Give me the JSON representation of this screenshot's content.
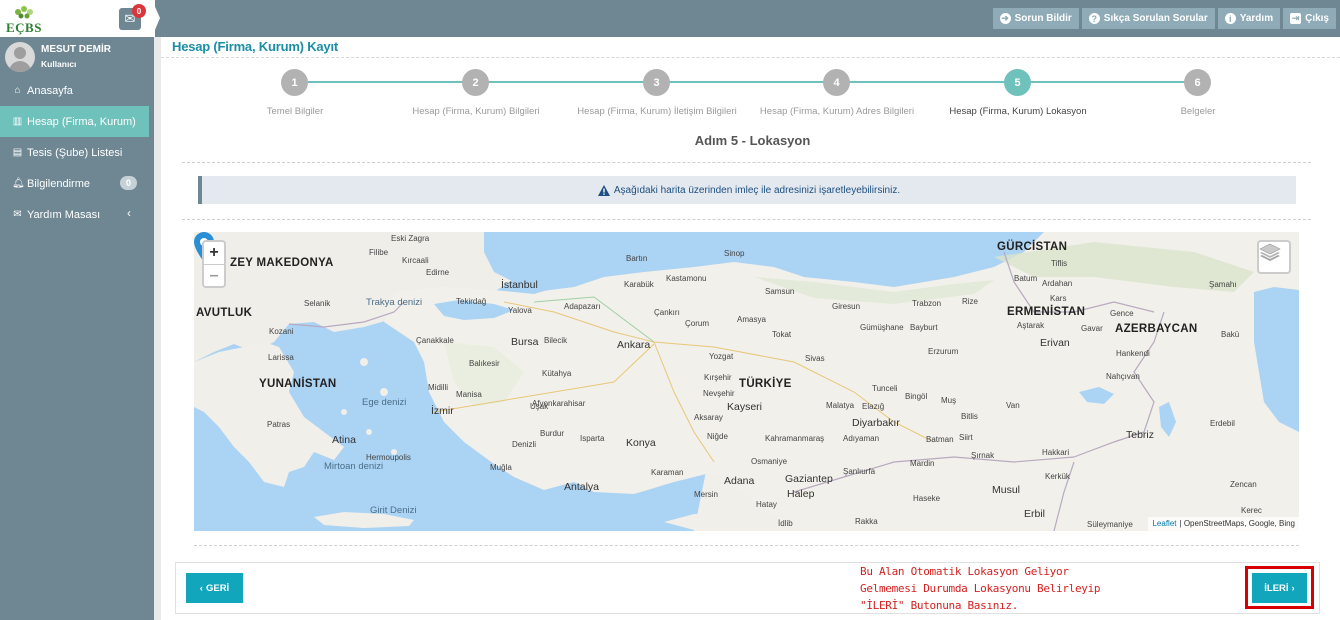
{
  "brand": {
    "logo_text": "EÇBS"
  },
  "notifications": {
    "mail_count": "0"
  },
  "topbar": {
    "buttons": [
      {
        "label": "Sorun Bildir",
        "icon": "arrow-circle-icon"
      },
      {
        "label": "Sıkça Sorulan Sorular",
        "icon": "question-circle-icon"
      },
      {
        "label": "Yardım",
        "icon": "info-circle-icon"
      },
      {
        "label": "Çıkış",
        "icon": "sign-out-icon"
      }
    ]
  },
  "user": {
    "name": "MESUT DEMİR",
    "role": "Kullanıcı"
  },
  "sidebar": {
    "items": [
      {
        "label": "Anasayfa",
        "icon": "home-icon"
      },
      {
        "label": "Hesap (Firma, Kurum)",
        "icon": "building-icon",
        "active": true
      },
      {
        "label": "Tesis (Şube) Listesi",
        "icon": "store-icon"
      },
      {
        "label": "Bilgilendirme",
        "icon": "bell-icon",
        "badge": "0"
      },
      {
        "label": "Yardım Masası",
        "icon": "envelope-icon"
      }
    ]
  },
  "page": {
    "title": "Hesap (Firma, Kurum) Kayıt"
  },
  "stepper": {
    "steps": [
      {
        "number": "1",
        "label": "Temel Bilgiler"
      },
      {
        "number": "2",
        "label": "Hesap (Firma, Kurum) Bilgileri"
      },
      {
        "number": "3",
        "label": "Hesap (Firma, Kurum) İletişim Bilgileri"
      },
      {
        "number": "4",
        "label": "Hesap (Firma, Kurum) Adres Bilgileri"
      },
      {
        "number": "5",
        "label": "Hesap (Firma, Kurum) Lokasyon",
        "active": true
      },
      {
        "number": "6",
        "label": "Belgeler"
      }
    ],
    "heading": "Adım 5 - Lokasyon"
  },
  "info": {
    "text": "Aşağıdaki harita üzerinden imleç ile adresinizi işaretleyebilirsiniz."
  },
  "map": {
    "zoom_in": "+",
    "zoom_out": "–",
    "attribution_link": "Leaflet",
    "attribution_text": "| OpenStreetMaps, Google, Bing",
    "countries": [
      "ZEY MAKEDONYA",
      "GÜRCİSTAN",
      "AVUTLUK",
      "ERMENİSTAN",
      "AZERBAYCAN",
      "YUNANİSTAN",
      "TÜRKİYE"
    ],
    "major_cities": [
      "İstanbul",
      "Bursa",
      "Ankara",
      "İzmir",
      "Kayseri",
      "Konya",
      "Atina",
      "Adana",
      "Antalya",
      "Gaziantep",
      "Halep",
      "Diyarbakır",
      "Erivan",
      "Tebriz",
      "Musul",
      "Erbil",
      "Tiflis"
    ],
    "seas": [
      "Trakya denizi",
      "Ege denizi",
      "Mirtoan denizi",
      "Girit Denizi"
    ],
    "small_places": [
      "Eski Zagra",
      "Filibe",
      "Kırcaali",
      "Edirne",
      "Selanik",
      "Tekirdağ",
      "Yalova",
      "Adapazarı",
      "Karabük",
      "Kastamonu",
      "Sinop",
      "Bartın",
      "Çankırı",
      "Çorum",
      "Amasya",
      "Samsun",
      "Giresun",
      "Trabzon",
      "Rize",
      "Gümüşhane",
      "Bayburt",
      "Erzurum",
      "Kars",
      "Ardahan",
      "Batum",
      "Yozgat",
      "Tokat",
      "Sivas",
      "Kırşehir",
      "Nevşehir",
      "Malatya",
      "Elazığ",
      "Tunceli",
      "Bingöl",
      "Muş",
      "Van",
      "Bitlis",
      "Siirt",
      "Batman",
      "Şırnak",
      "Hakkari",
      "Mardin",
      "Şanlıurfa",
      "Adıyaman",
      "Kahramanmaraş",
      "Osmaniye",
      "Hatay",
      "Aksaray",
      "Niğde",
      "Karaman",
      "Mersin",
      "Kütahya",
      "Afyonkarahisar",
      "Uşak",
      "Manisa",
      "Denizli",
      "Isparta",
      "Burdur",
      "Muğla",
      "Bilecik",
      "Balıkesir",
      "Çanakkale",
      "Midilli",
      "Larissa",
      "Kozani",
      "Patras",
      "Hermoupolis",
      "İdlib",
      "Rakka",
      "Haseke",
      "Kerkük",
      "Süleymaniye",
      "Erdebil",
      "Bakü",
      "Gence",
      "Şamahı",
      "Hankendi",
      "Nahçıvan",
      "Aştarak",
      "Gavar",
      "Zencan",
      "Kerec"
    ]
  },
  "nav": {
    "back_label": "GERİ",
    "next_label": "İLERİ",
    "note_lines": [
      "Bu Alan Otomatik Lokasyon Geliyor",
      "Gelmemesi Durumda Lokasyonu Belirleyip",
      "\"İLERİ\" Butonuna Basınız."
    ]
  },
  "colors": {
    "topbar": "#6e8792",
    "accent": "#6fc1bb",
    "button": "#12a6bd",
    "title": "#1a8ea5",
    "note": "#d42020"
  }
}
